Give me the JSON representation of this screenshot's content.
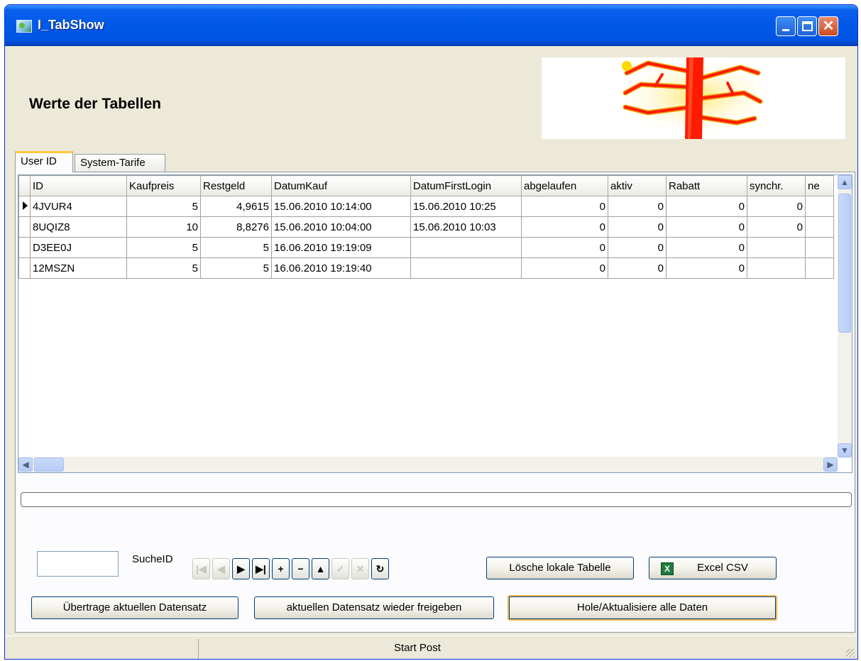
{
  "window": {
    "title": "I_TabShow",
    "close_glyph": "✕"
  },
  "header": {
    "heading": "Werte der Tabellen"
  },
  "tabs": [
    {
      "label": "User ID",
      "active": true
    },
    {
      "label": "System-Tarife",
      "active": false
    }
  ],
  "table": {
    "columns": [
      "ID",
      "Kaufpreis",
      "Restgeld",
      "DatumKauf",
      "DatumFirstLogin",
      "abgelaufen",
      "aktiv",
      "Rabatt",
      "synchr.",
      "ne"
    ],
    "rows": [
      {
        "current": true,
        "cells": [
          "4JVUR4",
          "5",
          "4,9615",
          "15.06.2010 10:14:00",
          "15.06.2010 10:25",
          "0",
          "0",
          "0",
          "0",
          ""
        ]
      },
      {
        "current": false,
        "cells": [
          "8UQIZ8",
          "10",
          "8,8276",
          "15.06.2010 10:04:00",
          "15.06.2010 10:03",
          "0",
          "0",
          "0",
          "0",
          ""
        ]
      },
      {
        "current": false,
        "cells": [
          "D3EE0J",
          "5",
          "5",
          "16.06.2010 19:19:09",
          "",
          "0",
          "0",
          "0",
          "",
          ""
        ]
      },
      {
        "current": false,
        "cells": [
          "12MSZN",
          "5",
          "5",
          "16.06.2010 19:19:40",
          "",
          "0",
          "0",
          "0",
          "",
          ""
        ]
      }
    ]
  },
  "search": {
    "label": "SucheID",
    "value": ""
  },
  "navigator": [
    {
      "name": "first-record-button",
      "glyph": "|◀",
      "enabled": false
    },
    {
      "name": "prior-record-button",
      "glyph": "◀",
      "enabled": false
    },
    {
      "name": "next-record-button",
      "glyph": "▶",
      "enabled": true
    },
    {
      "name": "last-record-button",
      "glyph": "▶|",
      "enabled": true
    },
    {
      "name": "insert-record-button",
      "glyph": "+",
      "enabled": true
    },
    {
      "name": "delete-record-button",
      "glyph": "−",
      "enabled": true
    },
    {
      "name": "edit-record-button",
      "glyph": "▲",
      "enabled": true
    },
    {
      "name": "post-record-button",
      "glyph": "✓",
      "enabled": false
    },
    {
      "name": "cancel-record-button",
      "glyph": "✕",
      "enabled": false
    },
    {
      "name": "refresh-record-button",
      "glyph": "↻",
      "enabled": true
    }
  ],
  "buttons": {
    "delete_local": "Lösche lokale Tabelle",
    "excel_csv": "Excel CSV",
    "transfer_record": "Übertrage aktuellen Datensatz",
    "release_record": "aktuellen Datensatz wieder freigeben",
    "fetch_all": "Hole/Aktualisiere alle Daten"
  },
  "statusbar": {
    "text": "Start Post"
  },
  "colors": {
    "titlebar": "#0054e3",
    "window_bg": "#ece9d8",
    "logo_trunk": "#ff1a00",
    "logo_branch": "#ffd800"
  }
}
